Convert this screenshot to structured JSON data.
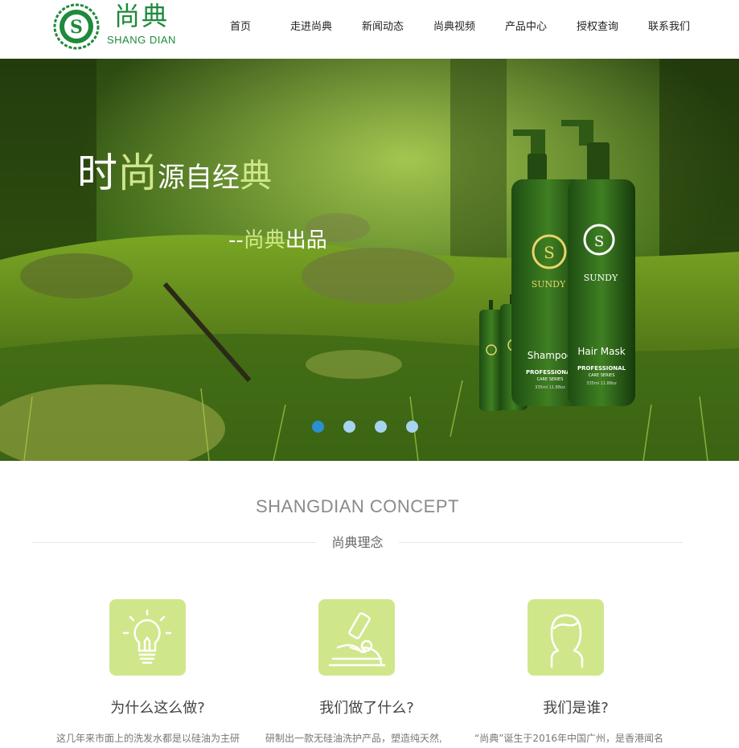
{
  "brand": {
    "name_cn": "尚典",
    "name_en": "SHANG DIAN"
  },
  "nav": {
    "items": [
      "首页",
      "走进尚典",
      "新闻动态",
      "尚典视频",
      "产品中心",
      "授权查询",
      "联系我们"
    ]
  },
  "banner": {
    "headline_parts": [
      "时",
      "尚",
      "源自经",
      "典"
    ],
    "subline_prefix": "--",
    "subline_highlight": "尚典",
    "subline_suffix": "出品",
    "products": [
      {
        "brand": "SUNDY",
        "name": "Shampoo",
        "line": "PROFESSIONAL",
        "series": "CARE SERIES",
        "volume": "335ml 11.88oz"
      },
      {
        "brand": "SUNDY",
        "name": "Hair Mask",
        "line": "PROFESSIONAL",
        "series": "CARE SERIES",
        "volume": "335ml 11.88oz"
      }
    ],
    "slide_count": 4,
    "active_slide": 1
  },
  "concept": {
    "title": "SHANGDIAN CONCEPT",
    "subtitle": "尚典理念",
    "features": [
      {
        "icon": "lightbulb-icon",
        "title": "为什么这么做?",
        "text": "这几年来市面上的洗发水都是以硅油为主研"
      },
      {
        "icon": "microscope-icon",
        "title": "我们做了什么?",
        "text": "研制出一款无硅油洗护产品，塑造纯天然,"
      },
      {
        "icon": "person-icon",
        "title": "我们是谁?",
        "text": "“尚典”诞生于2016年中国广州，是香港闻名"
      }
    ]
  },
  "colors": {
    "brand_green": "#1e8a3b",
    "accent_lime": "#cfe78a",
    "dot_active": "#2b8fd0",
    "dot_inactive": "#a7d4f0"
  }
}
